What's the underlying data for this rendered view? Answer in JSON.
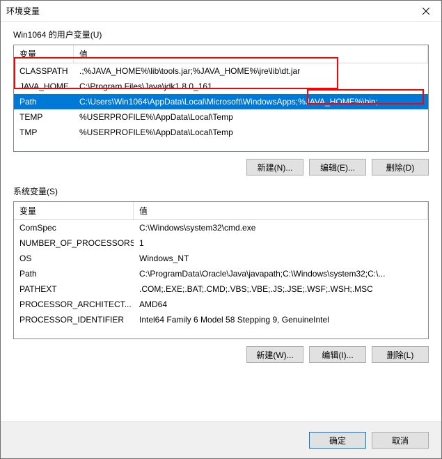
{
  "title": "环境变量",
  "columns": {
    "variable": "变量",
    "value": "值"
  },
  "user": {
    "label": "Win1064 的用户变量(U)",
    "rows": [
      {
        "name": "CLASSPATH",
        "value": ".;%JAVA_HOME%\\lib\\tools.jar;%JAVA_HOME%\\jre\\lib\\dt.jar",
        "selected": false
      },
      {
        "name": "JAVA_HOME",
        "value": "C:\\Program Files\\Java\\jdk1.8.0_161",
        "selected": false
      },
      {
        "name": "Path",
        "value": "C:\\Users\\Win1064\\AppData\\Local\\Microsoft\\WindowsApps;%JAVA_HOME%\\bin;",
        "selected": true
      },
      {
        "name": "TEMP",
        "value": "%USERPROFILE%\\AppData\\Local\\Temp",
        "selected": false
      },
      {
        "name": "TMP",
        "value": "%USERPROFILE%\\AppData\\Local\\Temp",
        "selected": false
      }
    ],
    "buttons": {
      "new": "新建(N)...",
      "edit": "编辑(E)...",
      "delete": "删除(D)"
    }
  },
  "system": {
    "label": "系统变量(S)",
    "rows": [
      {
        "name": "ComSpec",
        "value": "C:\\Windows\\system32\\cmd.exe",
        "selected": false
      },
      {
        "name": "NUMBER_OF_PROCESSORS",
        "value": "1",
        "selected": false
      },
      {
        "name": "OS",
        "value": "Windows_NT",
        "selected": false
      },
      {
        "name": "Path",
        "value": "C:\\ProgramData\\Oracle\\Java\\javapath;C:\\Windows\\system32;C:\\...",
        "selected": false
      },
      {
        "name": "PATHEXT",
        "value": ".COM;.EXE;.BAT;.CMD;.VBS;.VBE;.JS;.JSE;.WSF;.WSH;.MSC",
        "selected": false
      },
      {
        "name": "PROCESSOR_ARCHITECT...",
        "value": "AMD64",
        "selected": false
      },
      {
        "name": "PROCESSOR_IDENTIFIER",
        "value": "Intel64 Family 6 Model 58 Stepping 9, GenuineIntel",
        "selected": false
      }
    ],
    "buttons": {
      "new": "新建(W)...",
      "edit": "编辑(I)...",
      "delete": "删除(L)"
    }
  },
  "footer": {
    "ok": "确定",
    "cancel": "取消"
  }
}
